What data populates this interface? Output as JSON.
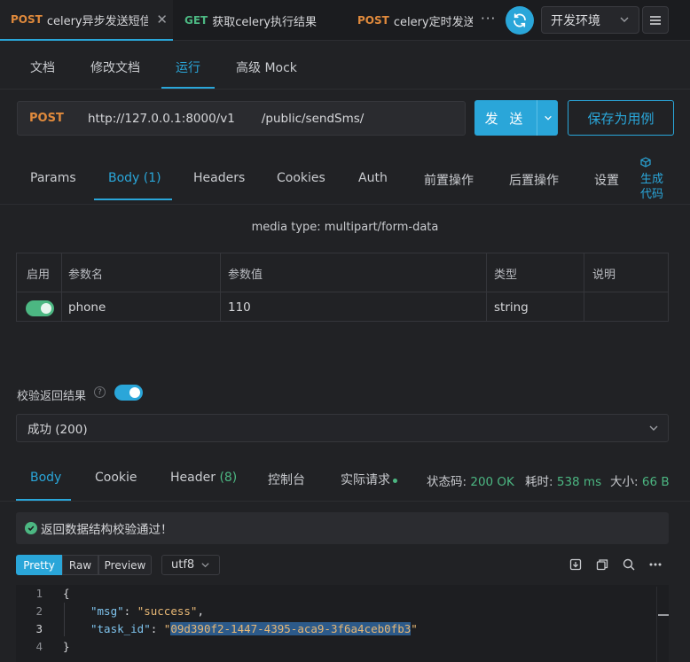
{
  "top_tabs": [
    {
      "method": "POST",
      "title": "celery异步发送短信"
    },
    {
      "method": "GET",
      "title": "获取celery执行结果"
    },
    {
      "method": "POST",
      "title": "celery定时发送"
    }
  ],
  "top_more": "···",
  "environment": "开发环境",
  "sub_tabs": [
    "文档",
    "修改文档",
    "运行",
    "高级 Mock"
  ],
  "request": {
    "method": "POST",
    "url": "http://127.0.0.1:8000/v1       /public/sendSms/",
    "send_label": "发 送",
    "save_label": "保存为用例"
  },
  "param_tabs": [
    "Params",
    "Body (1)",
    "Headers",
    "Cookies",
    "Auth",
    "前置操作",
    "后置操作",
    "设置"
  ],
  "generate_code": {
    "line1": "生成",
    "line2": "代码"
  },
  "media_type": "media type: multipart/form-data",
  "table": {
    "headers": [
      "启用",
      "参数名",
      "参数值",
      "类型",
      "说明"
    ],
    "rows": [
      {
        "enabled": true,
        "name": "phone",
        "value": "110",
        "type": "string",
        "desc": ""
      }
    ]
  },
  "validation": {
    "label": "校验返回结果",
    "help": "?",
    "enabled": true,
    "selected": "成功 (200)",
    "message": "返回数据结构校验通过！"
  },
  "response_tabs": {
    "body": "Body",
    "cookie": "Cookie",
    "header_label": "Header",
    "header_count": "(8)",
    "console": "控制台",
    "actual": "实际请求"
  },
  "status": {
    "code_label": "状态码:",
    "code": "200 OK",
    "time_label": "耗时:",
    "time": "538 ms",
    "size_label": "大小:",
    "size": "66 B"
  },
  "view_modes": [
    "Pretty",
    "Raw",
    "Preview"
  ],
  "encoding": "utf8",
  "code": {
    "line_numbers": [
      "1",
      "2",
      "3",
      "4"
    ],
    "open_brace": "{",
    "close_brace": "}",
    "msg_key": "\"msg\"",
    "msg_value": "\"success\"",
    "task_key": "\"task_id\"",
    "task_value": "09d390f2-1447-4395-aca9-3f6a4ceb0fb3",
    "colon": ": ",
    "comma": ",",
    "quote": "\""
  },
  "colors": {
    "accent": "#2aa6d9",
    "post": "#e08a3c",
    "get": "#4cb782",
    "background": "#212225"
  }
}
